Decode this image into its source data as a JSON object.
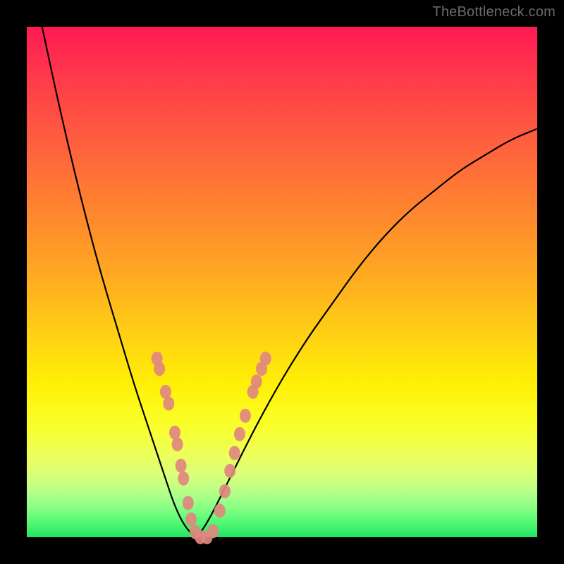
{
  "watermark": "TheBottleneck.com",
  "chart_data": {
    "type": "line",
    "title": "",
    "xlabel": "",
    "ylabel": "",
    "xlim": [
      0,
      1
    ],
    "ylim": [
      0,
      1
    ],
    "series": [
      {
        "name": "curve",
        "x": [
          0.03,
          0.06,
          0.09,
          0.12,
          0.15,
          0.18,
          0.21,
          0.24,
          0.27,
          0.29,
          0.31,
          0.33,
          0.35,
          0.4,
          0.45,
          0.5,
          0.55,
          0.6,
          0.65,
          0.7,
          0.75,
          0.8,
          0.85,
          0.9,
          0.95,
          1.0
        ],
        "y": [
          1.0,
          0.86,
          0.73,
          0.61,
          0.5,
          0.4,
          0.3,
          0.21,
          0.12,
          0.06,
          0.02,
          0.0,
          0.02,
          0.12,
          0.22,
          0.31,
          0.39,
          0.46,
          0.53,
          0.59,
          0.64,
          0.68,
          0.72,
          0.75,
          0.78,
          0.8
        ]
      }
    ],
    "markers": [
      {
        "x": 0.255,
        "y": 0.35
      },
      {
        "x": 0.26,
        "y": 0.33
      },
      {
        "x": 0.272,
        "y": 0.285
      },
      {
        "x": 0.278,
        "y": 0.262
      },
      {
        "x": 0.29,
        "y": 0.205
      },
      {
        "x": 0.295,
        "y": 0.182
      },
      {
        "x": 0.302,
        "y": 0.14
      },
      {
        "x": 0.307,
        "y": 0.115
      },
      {
        "x": 0.316,
        "y": 0.067
      },
      {
        "x": 0.322,
        "y": 0.035
      },
      {
        "x": 0.33,
        "y": 0.01
      },
      {
        "x": 0.34,
        "y": 0.0
      },
      {
        "x": 0.353,
        "y": 0.0
      },
      {
        "x": 0.365,
        "y": 0.012
      },
      {
        "x": 0.378,
        "y": 0.052
      },
      {
        "x": 0.388,
        "y": 0.09
      },
      {
        "x": 0.398,
        "y": 0.13
      },
      {
        "x": 0.407,
        "y": 0.165
      },
      {
        "x": 0.417,
        "y": 0.202
      },
      {
        "x": 0.428,
        "y": 0.238
      },
      {
        "x": 0.443,
        "y": 0.285
      },
      {
        "x": 0.45,
        "y": 0.305
      },
      {
        "x": 0.46,
        "y": 0.33
      },
      {
        "x": 0.468,
        "y": 0.35
      }
    ],
    "marker_color": "#e0887f",
    "curve_color": "#000000"
  }
}
